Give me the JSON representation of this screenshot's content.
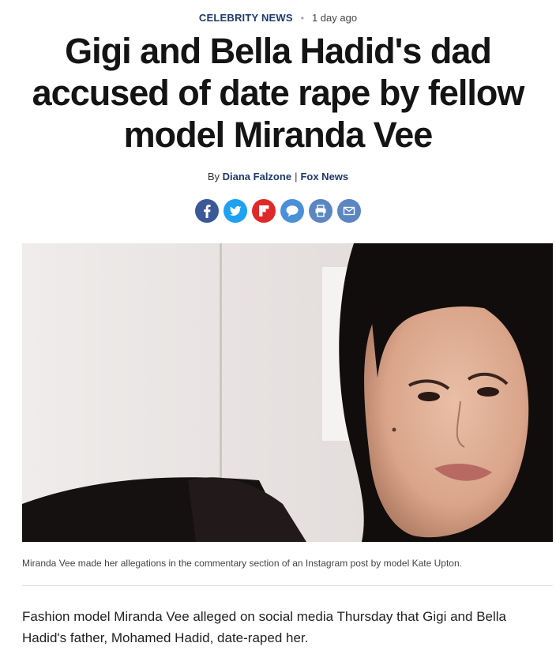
{
  "article": {
    "category": "CELEBRITY NEWS",
    "separator": "•",
    "time_ago": "1 day ago",
    "headline": "Gigi and Bella Hadid's dad accused of date rape by fellow model Miranda Vee",
    "byline": {
      "prefix": "By ",
      "author": "Diana Falzone",
      "divider": "|",
      "outlet": "Fox News"
    },
    "share_buttons": [
      {
        "icon": "facebook-icon",
        "color": "#3b5998"
      },
      {
        "icon": "twitter-icon",
        "color": "#1da1f2"
      },
      {
        "icon": "flipboard-icon",
        "color": "#e12828"
      },
      {
        "icon": "comment-icon",
        "color": "#4a90d9"
      },
      {
        "icon": "print-icon",
        "color": "#5b86c2"
      },
      {
        "icon": "email-icon",
        "color": "#5b86c2"
      }
    ],
    "image": {
      "subject": "Miranda Vee selfie photo"
    },
    "caption": "Miranda Vee made her allegations in the commentary section of an Instagram post by model Kate Upton.",
    "lead": "Fashion model Miranda Vee alleged on social media Thursday that Gigi and Bella Hadid's father, Mohamed Hadid, date-raped her."
  },
  "colors": {
    "brand_navy": "#1d3a6b",
    "facebook": "#3b5998",
    "twitter": "#1da1f2",
    "flipboard": "#e12828"
  }
}
